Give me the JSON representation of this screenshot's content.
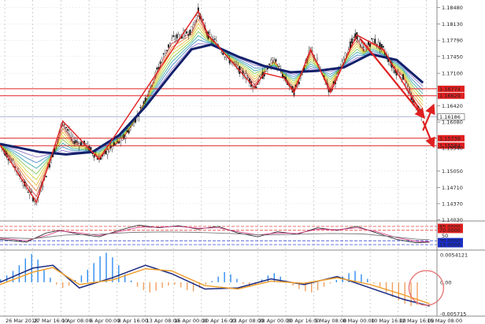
{
  "colors": {
    "level_line": "#e02020",
    "current_price_line": "#9aa4c8",
    "main_ma": "#12206b",
    "zigzag": "#e02020",
    "rsi_line": "#7a7a7a",
    "stoch_main": "#1b1b1b",
    "stoch_signal": "#d03080",
    "level_80": "#e02020",
    "level_20": "#1b2ec8",
    "hist_pos": "#2f8cf0",
    "hist_neg": "#f0a060",
    "osc_line_a": "#1c2a80",
    "osc_line_b": "#f0a030",
    "circle": "#e87070",
    "ribbon": [
      "#c81e1e",
      "#e07020",
      "#e8b020",
      "#c8d020",
      "#70c040",
      "#20a0a0",
      "#3080c0",
      "#8060c0"
    ]
  },
  "chart_data": [
    {
      "type": "line",
      "panel": "price",
      "title": "",
      "xlabel": "",
      "ylabel": "",
      "ylim": [
        1.1404,
        1.186
      ],
      "y_ticks": [
        "1.18480",
        "1.18130",
        "1.17790",
        "1.17450",
        "1.17100",
        "1.16420",
        "1.16080",
        "1.15540",
        "1.15050",
        "1.14710",
        "1.14370",
        "1.14030"
      ],
      "x_ticks": [
        "26 Mar 2018",
        "27 Mar 16:00",
        "1 Apr 08:00",
        "6 Apr 00:00",
        "8 Apr 16:00",
        "13 Apr 08:00",
        "16 Apr 00:00",
        "20 Apr 16:00",
        "23 Apr 08:00",
        "28 Apr 00:00",
        "30 Apr 16:00",
        "5 May 08:00",
        "8 May 00:00",
        "10 May 16:00",
        "12 May 16:00",
        "15 May 08:00"
      ],
      "levels": [
        {
          "label": "1.16774",
          "value": 1.16774
        },
        {
          "label": "1.16629",
          "value": 1.16629
        },
        {
          "label": "1.15739",
          "value": 1.15739
        },
        {
          "label": "1.15584",
          "value": 1.15584
        }
      ],
      "current_price": {
        "label": "1.16186",
        "value": 1.16186
      },
      "price_path": [
        [
          0,
          1.156
        ],
        [
          4,
          1.152
        ],
        [
          8,
          1.147
        ],
        [
          11,
          1.144
        ],
        [
          14,
          1.15
        ],
        [
          17,
          1.156
        ],
        [
          19,
          1.161
        ],
        [
          22,
          1.157
        ],
        [
          26,
          1.156
        ],
        [
          30,
          1.153
        ],
        [
          34,
          1.1555
        ],
        [
          37,
          1.157
        ],
        [
          40,
          1.16
        ],
        [
          43,
          1.164
        ],
        [
          46,
          1.169
        ],
        [
          49,
          1.174
        ],
        [
          52,
          1.178
        ],
        [
          55,
          1.179
        ],
        [
          58,
          1.18
        ],
        [
          60,
          1.184
        ],
        [
          63,
          1.179
        ],
        [
          66,
          1.177
        ],
        [
          69,
          1.174
        ],
        [
          72,
          1.172
        ],
        [
          75,
          1.17
        ],
        [
          77,
          1.168
        ],
        [
          80,
          1.171
        ],
        [
          83,
          1.174
        ],
        [
          86,
          1.17
        ],
        [
          89,
          1.167
        ],
        [
          92,
          1.172
        ],
        [
          94,
          1.176
        ],
        [
          96,
          1.1735
        ],
        [
          98,
          1.17
        ],
        [
          100,
          1.167
        ],
        [
          103,
          1.172
        ],
        [
          106,
          1.177
        ],
        [
          108,
          1.179
        ],
        [
          110,
          1.176
        ],
        [
          113,
          1.178
        ],
        [
          116,
          1.176
        ],
        [
          119,
          1.172
        ],
        [
          122,
          1.17
        ],
        [
          125,
          1.165
        ],
        [
          128,
          1.162
        ]
      ],
      "series": [
        {
          "values": [
            [
              0,
              1.1562
            ],
            [
              12,
              1.1545
            ],
            [
              20,
              1.154
            ],
            [
              28,
              1.1545
            ],
            [
              36,
              1.158
            ],
            [
              44,
              1.164
            ],
            [
              52,
              1.171
            ],
            [
              58,
              1.176
            ],
            [
              64,
              1.177
            ],
            [
              72,
              1.1745
            ],
            [
              80,
              1.1725
            ],
            [
              88,
              1.1712
            ],
            [
              96,
              1.1715
            ],
            [
              104,
              1.1722
            ],
            [
              112,
              1.175
            ],
            [
              120,
              1.1738
            ],
            [
              128,
              1.169
            ]
          ]
        }
      ],
      "annotations": [
        {
          "type": "arrow-down",
          "from": [
            109,
            1.1782
          ],
          "to": [
            128,
            1.162
          ]
        },
        {
          "type": "arrow-up",
          "from": [
            128,
            1.159
          ],
          "to": [
            131,
            1.164
          ]
        },
        {
          "type": "arrow-down",
          "from": [
            128,
            1.161
          ],
          "to": [
            131,
            1.156
          ]
        }
      ]
    },
    {
      "type": "line",
      "panel": "oscillator",
      "title": "",
      "ylim": [
        0,
        100
      ],
      "y_ticks": [
        "85.0000",
        "70.0000",
        "50",
        "30.0000",
        "15.0000"
      ],
      "levels": [
        85,
        70,
        30,
        15
      ],
      "series": [
        {
          "values": [
            [
              0,
              35
            ],
            [
              8,
              25
            ],
            [
              14,
              60
            ],
            [
              18,
              70
            ],
            [
              24,
              55
            ],
            [
              30,
              45
            ],
            [
              36,
              70
            ],
            [
              42,
              90
            ],
            [
              48,
              80
            ],
            [
              54,
              88
            ],
            [
              60,
              75
            ],
            [
              66,
              85
            ],
            [
              72,
              60
            ],
            [
              78,
              45
            ],
            [
              84,
              65
            ],
            [
              90,
              55
            ],
            [
              96,
              80
            ],
            [
              102,
              70
            ],
            [
              108,
              85
            ],
            [
              114,
              60
            ],
            [
              120,
              35
            ],
            [
              126,
              22
            ],
            [
              130,
              25
            ]
          ]
        },
        {
          "values": [
            [
              0,
              40
            ],
            [
              8,
              30
            ],
            [
              14,
              50
            ],
            [
              18,
              68
            ],
            [
              24,
              60
            ],
            [
              30,
              50
            ],
            [
              36,
              65
            ],
            [
              42,
              82
            ],
            [
              48,
              82
            ],
            [
              54,
              85
            ],
            [
              60,
              78
            ],
            [
              66,
              80
            ],
            [
              72,
              65
            ],
            [
              78,
              52
            ],
            [
              84,
              60
            ],
            [
              90,
              58
            ],
            [
              96,
              75
            ],
            [
              102,
              72
            ],
            [
              108,
              80
            ],
            [
              114,
              65
            ],
            [
              120,
              42
            ],
            [
              126,
              28
            ],
            [
              130,
              26
            ]
          ]
        },
        {
          "values": [
            [
              0,
              42
            ],
            [
              10,
              38
            ],
            [
              20,
              52
            ],
            [
              30,
              55
            ],
            [
              40,
              62
            ],
            [
              50,
              64
            ],
            [
              60,
              62
            ],
            [
              70,
              58
            ],
            [
              80,
              52
            ],
            [
              90,
              55
            ],
            [
              100,
              58
            ],
            [
              110,
              56
            ],
            [
              120,
              44
            ],
            [
              126,
              36
            ],
            [
              130,
              34
            ]
          ]
        }
      ]
    },
    {
      "type": "bar",
      "panel": "histogram",
      "title": "",
      "ylim": [
        -0.005715,
        0.005412
      ],
      "y_ticks": [
        "0.0054121",
        "0.00",
        "-0.005715"
      ],
      "values": [
        0.0005,
        0.0012,
        0.002,
        0.003,
        0.0042,
        0.005,
        0.004,
        0.0022,
        0.0008,
        -0.0004,
        -0.001,
        -0.0006,
        0.0004,
        0.0012,
        0.0022,
        0.0034,
        0.0046,
        0.0052,
        0.0044,
        0.003,
        0.0014,
        0.0003,
        -0.0008,
        -0.0014,
        -0.0018,
        -0.0015,
        -0.001,
        -0.0006,
        -0.0004,
        -0.0009,
        -0.0014,
        -0.0016,
        -0.001,
        -0.0004,
        0.0002,
        0.001,
        0.0018,
        0.0014,
        0.0006,
        -0.0003,
        -0.0008,
        -0.0004,
        0.0005,
        0.0012,
        0.0016,
        0.001,
        0.0002,
        -0.0006,
        -0.0012,
        -0.0016,
        -0.0018,
        -0.0014,
        -0.0008,
        -0.0002,
        0.0004,
        0.001,
        0.0016,
        0.002,
        0.0014,
        0.0006,
        -0.0002,
        -0.001,
        -0.0018,
        -0.0026,
        -0.0032,
        -0.0038,
        -0.0042,
        -0.004
      ],
      "series": [
        {
          "values": [
            [
              0,
              0.0
            ],
            [
              10,
              0.0025
            ],
            [
              16,
              0.003
            ],
            [
              24,
              -0.001
            ],
            [
              34,
              0.0008
            ],
            [
              44,
              0.003
            ],
            [
              52,
              0.0015
            ],
            [
              62,
              -0.0012
            ],
            [
              72,
              -0.001
            ],
            [
              82,
              0.0006
            ],
            [
              92,
              -0.0004
            ],
            [
              102,
              0.001
            ],
            [
              112,
              -0.001
            ],
            [
              122,
              -0.003
            ],
            [
              130,
              -0.0042
            ]
          ]
        },
        {
          "values": [
            [
              0,
              -0.0004
            ],
            [
              10,
              0.0018
            ],
            [
              16,
              0.0026
            ],
            [
              24,
              -0.0004
            ],
            [
              34,
              0.0004
            ],
            [
              44,
              0.0024
            ],
            [
              52,
              0.002
            ],
            [
              62,
              -0.0006
            ],
            [
              72,
              -0.0012
            ],
            [
              82,
              0.0002
            ],
            [
              92,
              -0.0002
            ],
            [
              102,
              0.0008
            ],
            [
              112,
              -0.0004
            ],
            [
              122,
              -0.0022
            ],
            [
              130,
              -0.0038
            ]
          ]
        }
      ]
    }
  ]
}
